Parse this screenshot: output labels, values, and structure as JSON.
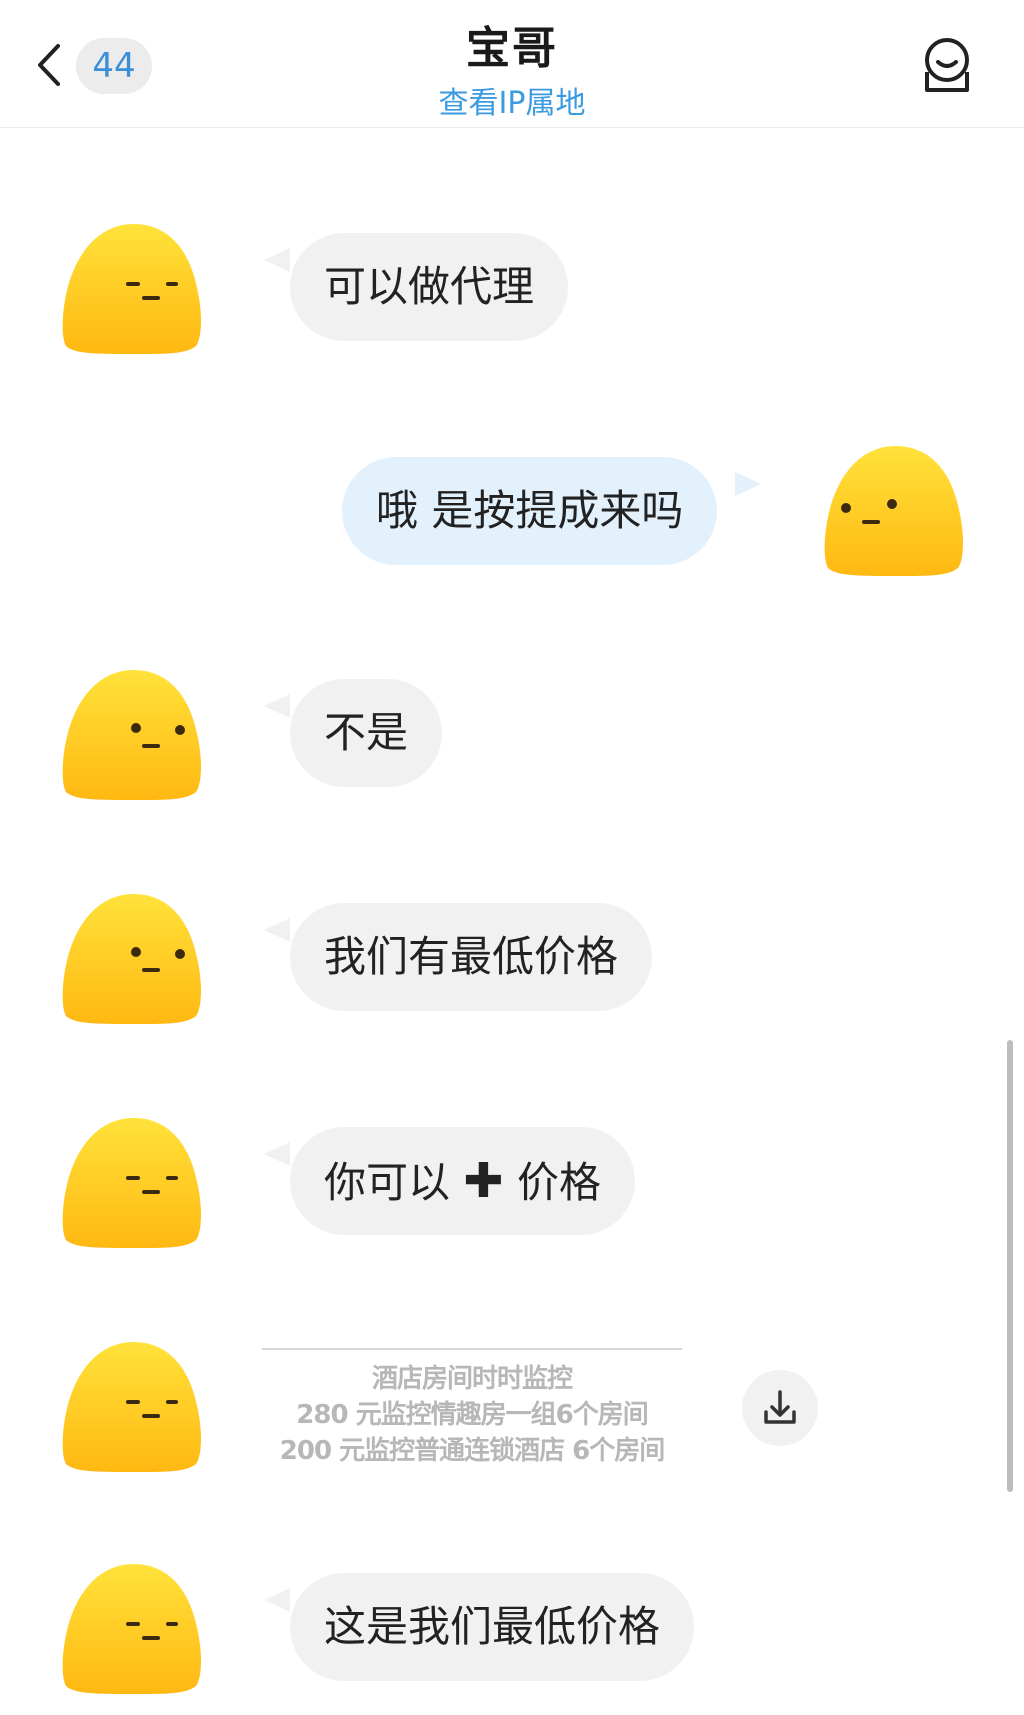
{
  "header": {
    "unread_count": "44",
    "title": "宝哥",
    "subtitle": "查看IP属地",
    "back_icon": "chevron-left-icon",
    "profile_icon": "person-icon"
  },
  "messages": [
    {
      "side": "in",
      "text": "可以做代理"
    },
    {
      "side": "out",
      "text": "哦 是按提成来吗"
    },
    {
      "side": "in",
      "text": "不是"
    },
    {
      "side": "in",
      "text": "我们有最低价格"
    },
    {
      "side": "in",
      "text_a": "你可以",
      "text_b": "价格"
    },
    {
      "side": "in",
      "type": "image",
      "image_lines": [
        "酒店房间时时监控",
        "280 元监控情趣房一组6个房间",
        "200 元监控普通连锁酒店 6个房间"
      ],
      "download_icon": "download-icon"
    },
    {
      "side": "in",
      "text": "这是我们最低价格"
    }
  ],
  "colors": {
    "incoming_bubble": "#f1f1f2",
    "outgoing_bubble": "#e3f1fd",
    "link_blue": "#3a9be0",
    "avatar_yellow": "#ffc91a"
  }
}
